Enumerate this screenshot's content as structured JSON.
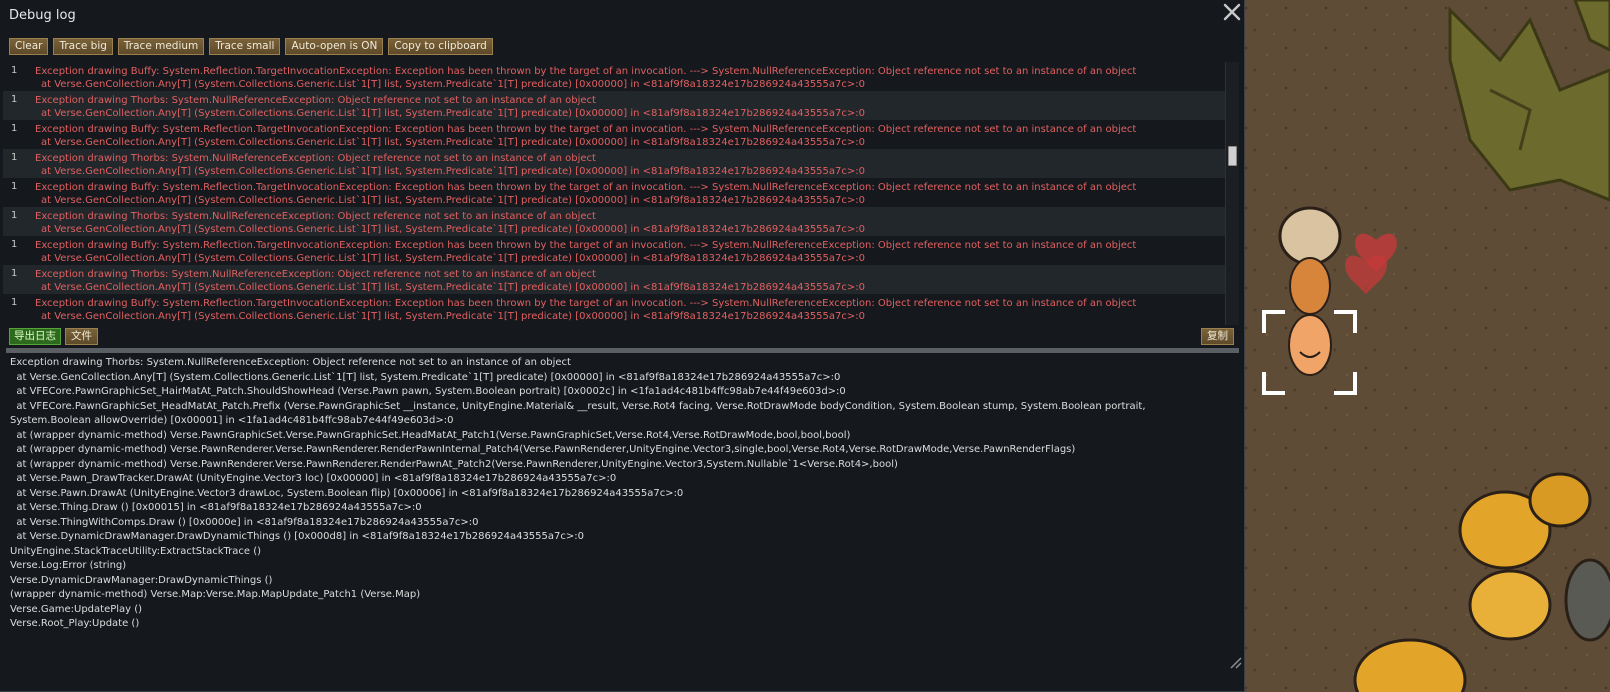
{
  "window": {
    "title": "Debug log",
    "close_icon": "close-icon"
  },
  "toolbar": {
    "buttons": [
      "Clear",
      "Trace big",
      "Trace medium",
      "Trace small",
      "Auto-open is ON",
      "Copy to clipboard"
    ]
  },
  "log_entries": [
    {
      "count": "1",
      "line1": "Exception drawing Buffy: System.Reflection.TargetInvocationException: Exception has been thrown by the target of an invocation. ---> System.NullReferenceException: Object reference not set to an instance of an object",
      "line2": "at Verse.GenCollection.Any[T] (System.Collections.Generic.List`1[T] list, System.Predicate`1[T] predicate) [0x00000] in <81af9f8a18324e17b286924a43555a7c>:0"
    },
    {
      "count": "1",
      "line1": "Exception drawing Thorbs: System.NullReferenceException: Object reference not set to an instance of an object",
      "line2": "at Verse.GenCollection.Any[T] (System.Collections.Generic.List`1[T] list, System.Predicate`1[T] predicate) [0x00000] in <81af9f8a18324e17b286924a43555a7c>:0"
    },
    {
      "count": "1",
      "line1": "Exception drawing Buffy: System.Reflection.TargetInvocationException: Exception has been thrown by the target of an invocation. ---> System.NullReferenceException: Object reference not set to an instance of an object",
      "line2": "at Verse.GenCollection.Any[T] (System.Collections.Generic.List`1[T] list, System.Predicate`1[T] predicate) [0x00000] in <81af9f8a18324e17b286924a43555a7c>:0"
    },
    {
      "count": "1",
      "line1": "Exception drawing Thorbs: System.NullReferenceException: Object reference not set to an instance of an object",
      "line2": "at Verse.GenCollection.Any[T] (System.Collections.Generic.List`1[T] list, System.Predicate`1[T] predicate) [0x00000] in <81af9f8a18324e17b286924a43555a7c>:0"
    },
    {
      "count": "1",
      "line1": "Exception drawing Buffy: System.Reflection.TargetInvocationException: Exception has been thrown by the target of an invocation. ---> System.NullReferenceException: Object reference not set to an instance of an object",
      "line2": "at Verse.GenCollection.Any[T] (System.Collections.Generic.List`1[T] list, System.Predicate`1[T] predicate) [0x00000] in <81af9f8a18324e17b286924a43555a7c>:0"
    },
    {
      "count": "1",
      "line1": "Exception drawing Thorbs: System.NullReferenceException: Object reference not set to an instance of an object",
      "line2": "at Verse.GenCollection.Any[T] (System.Collections.Generic.List`1[T] list, System.Predicate`1[T] predicate) [0x00000] in <81af9f8a18324e17b286924a43555a7c>:0"
    },
    {
      "count": "1",
      "line1": "Exception drawing Buffy: System.Reflection.TargetInvocationException: Exception has been thrown by the target of an invocation. ---> System.NullReferenceException: Object reference not set to an instance of an object",
      "line2": "at Verse.GenCollection.Any[T] (System.Collections.Generic.List`1[T] list, System.Predicate`1[T] predicate) [0x00000] in <81af9f8a18324e17b286924a43555a7c>:0"
    },
    {
      "count": "1",
      "line1": "Exception drawing Thorbs: System.NullReferenceException: Object reference not set to an instance of an object",
      "line2": "at Verse.GenCollection.Any[T] (System.Collections.Generic.List`1[T] list, System.Predicate`1[T] predicate) [0x00000] in <81af9f8a18324e17b286924a43555a7c>:0"
    },
    {
      "count": "1",
      "line1": "Exception drawing Buffy: System.Reflection.TargetInvocationException: Exception has been thrown by the target of an invocation. ---> System.NullReferenceException: Object reference not set to an instance of an object",
      "line2": "at Verse.GenCollection.Any[T] (System.Collections.Generic.List`1[T] list, System.Predicate`1[T] predicate) [0x00000] in <81af9f8a18324e17b286924a43555a7c>:0"
    }
  ],
  "subbar": {
    "export_label": "导出日志",
    "file_label": "文件",
    "copy_label": "复制"
  },
  "detail_lines": [
    "Exception drawing Thorbs: System.NullReferenceException: Object reference not set to an instance of an object",
    "  at Verse.GenCollection.Any[T] (System.Collections.Generic.List`1[T] list, System.Predicate`1[T] predicate) [0x00000] in <81af9f8a18324e17b286924a43555a7c>:0",
    "  at VFECore.PawnGraphicSet_HairMatAt_Patch.ShouldShowHead (Verse.Pawn pawn, System.Boolean portrait) [0x0002c] in <1fa1ad4c481b4ffc98ab7e44f49e603d>:0",
    "  at VFECore.PawnGraphicSet_HeadMatAt_Patch.Prefix (Verse.PawnGraphicSet __instance, UnityEngine.Material& __result, Verse.Rot4 facing, Verse.RotDrawMode bodyCondition, System.Boolean stump, System.Boolean portrait,",
    "System.Boolean allowOverride) [0x00001] in <1fa1ad4c481b4ffc98ab7e44f49e603d>:0",
    "  at (wrapper dynamic-method) Verse.PawnGraphicSet.Verse.PawnGraphicSet.HeadMatAt_Patch1(Verse.PawnGraphicSet,Verse.Rot4,Verse.RotDrawMode,bool,bool,bool)",
    "  at (wrapper dynamic-method) Verse.PawnRenderer.Verse.PawnRenderer.RenderPawnInternal_Patch4(Verse.PawnRenderer,UnityEngine.Vector3,single,bool,Verse.Rot4,Verse.RotDrawMode,Verse.PawnRenderFlags)",
    "  at (wrapper dynamic-method) Verse.PawnRenderer.Verse.PawnRenderer.RenderPawnAt_Patch2(Verse.PawnRenderer,UnityEngine.Vector3,System.Nullable`1<Verse.Rot4>,bool)",
    "  at Verse.Pawn_DrawTracker.DrawAt (UnityEngine.Vector3 loc) [0x00000] in <81af9f8a18324e17b286924a43555a7c>:0",
    "  at Verse.Pawn.DrawAt (UnityEngine.Vector3 drawLoc, System.Boolean flip) [0x00006] in <81af9f8a18324e17b286924a43555a7c>:0",
    "  at Verse.Thing.Draw () [0x00015] in <81af9f8a18324e17b286924a43555a7c>:0",
    "  at Verse.ThingWithComps.Draw () [0x0000e] in <81af9f8a18324e17b286924a43555a7c>:0",
    "  at Verse.DynamicDrawManager.DrawDynamicThings () [0x000d8] in <81af9f8a18324e17b286924a43555a7c>:0",
    "UnityEngine.StackTraceUtility:ExtractStackTrace ()",
    "Verse.Log:Error (string)",
    "Verse.DynamicDrawManager:DrawDynamicThings ()",
    "(wrapper dynamic-method) Verse.Map:Verse.Map.MapUpdate_Patch1 (Verse.Map)",
    "Verse.Game:UpdatePlay ()",
    "Verse.Root_Play:Update ()"
  ],
  "colors": {
    "error_text": "#e06060",
    "window_bg": "#15191e",
    "button_bg": "#6d5632",
    "export_bg": "#2d6a1e"
  }
}
